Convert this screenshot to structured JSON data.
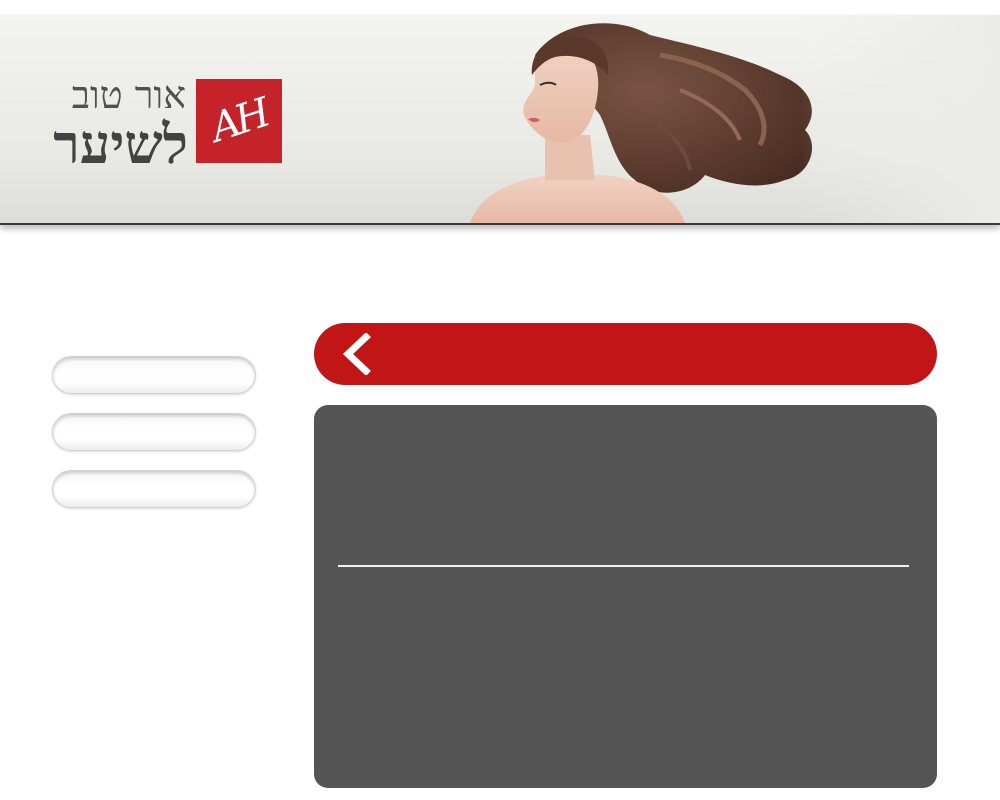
{
  "header": {
    "logo": {
      "line1": "אור טוב",
      "line2": "לשיער",
      "monogram": "AH"
    },
    "hero_image": "woman-with-flowing-curly-hair"
  },
  "sidebar": {
    "items": [
      {
        "label": ""
      },
      {
        "label": ""
      },
      {
        "label": ""
      }
    ]
  },
  "titlebar": {
    "back_icon": "chevron-left-icon",
    "title": ""
  },
  "panel": {
    "heading": "",
    "body": ""
  },
  "colors": {
    "accent_red": "#c21515",
    "logo_red": "#c4232a",
    "panel_gray": "#555555"
  }
}
